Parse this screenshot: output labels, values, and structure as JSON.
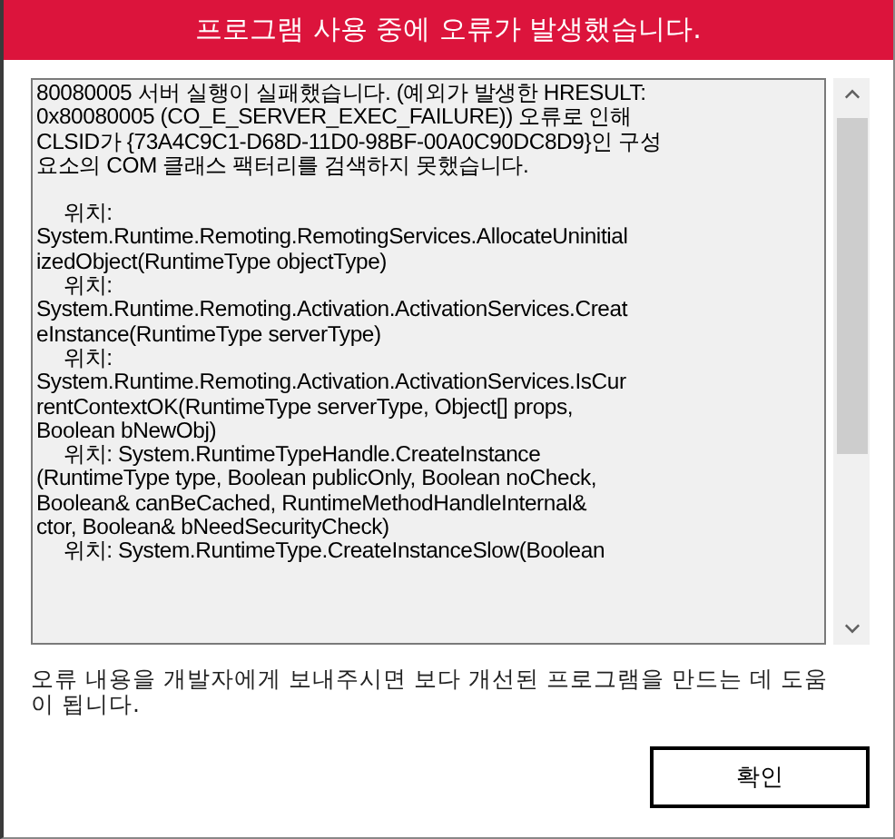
{
  "window": {
    "title": "프로그램 사용 중에 오류가 발생했습니다."
  },
  "details": {
    "summary": [
      "80080005 서버 실행이 실패했습니다. (예외가 발생한 HRESULT:",
      "0x80080005 (CO_E_SERVER_EXEC_FAILURE)) 오류로 인해",
      "CLSID가 {73A4C9C1-D68D-11D0-98BF-00A0C90DC8D9}인 구성",
      "요소의 COM 클래스 팩터리를 검색하지 못했습니다."
    ],
    "trace": [
      {
        "text": "위치:",
        "indent": true
      },
      {
        "text": "System.Runtime.Remoting.RemotingServices.AllocateUninitial",
        "indent": false
      },
      {
        "text": "izedObject(RuntimeType objectType)",
        "indent": false
      },
      {
        "text": "위치:",
        "indent": true
      },
      {
        "text": "System.Runtime.Remoting.Activation.ActivationServices.Creat",
        "indent": false
      },
      {
        "text": "eInstance(RuntimeType serverType)",
        "indent": false
      },
      {
        "text": "위치:",
        "indent": true
      },
      {
        "text": "System.Runtime.Remoting.Activation.ActivationServices.IsCur",
        "indent": false
      },
      {
        "text": "rentContextOK(RuntimeType serverType, Object[] props,",
        "indent": false
      },
      {
        "text": "Boolean bNewObj)",
        "indent": false
      },
      {
        "text": "위치: System.RuntimeTypeHandle.CreateInstance",
        "indent": true
      },
      {
        "text": "(RuntimeType type, Boolean publicOnly, Boolean noCheck,",
        "indent": false
      },
      {
        "text": "Boolean& canBeCached, RuntimeMethodHandleInternal&",
        "indent": false
      },
      {
        "text": "ctor, Boolean& bNeedSecurityCheck)",
        "indent": false
      },
      {
        "text": "위치: System.RuntimeType.CreateInstanceSlow(Boolean",
        "indent": true
      }
    ]
  },
  "message": "오류 내용을 개발자에게 보내주시면 보다 개선된 프로그램을 만드는 데 도움이 됩니다.",
  "buttons": [
    {
      "label": "확인"
    }
  ]
}
